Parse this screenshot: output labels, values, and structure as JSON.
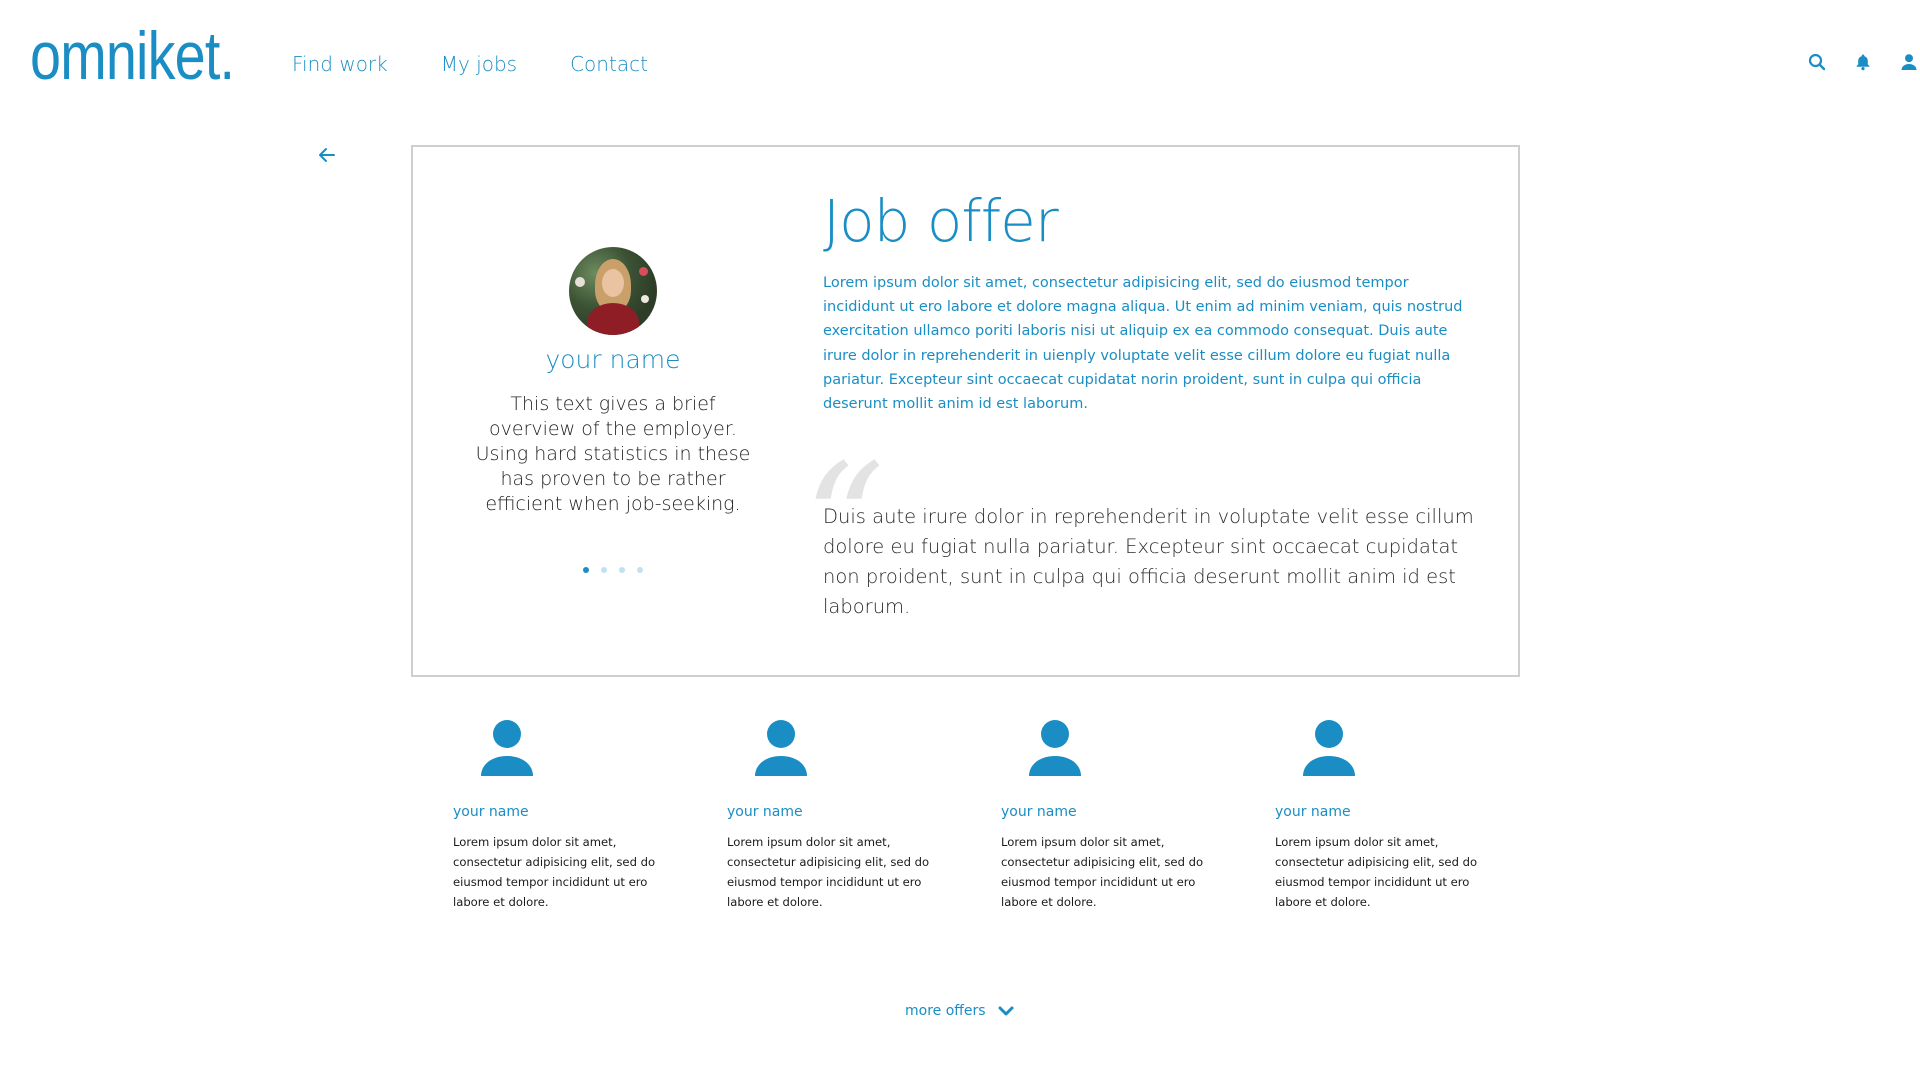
{
  "header": {
    "logo": "omniket.",
    "nav": [
      "Find work",
      "My jobs",
      "Contact"
    ],
    "icons": [
      "search-icon",
      "bell-icon",
      "user-icon"
    ]
  },
  "card": {
    "profile": {
      "name": "your name",
      "description": "This text gives a brief overview of the employer. Using hard statistics in these has proven to be rather efficient when job-seeking.",
      "carousel_dots": 4,
      "active_dot": 1
    },
    "title": "Job offer",
    "description": "Lorem ipsum dolor sit amet, consectetur adipisicing elit, sed do eiusmod tempor incididunt ut ero labore et dolore magna aliqua. Ut enim ad minim veniam, quis nostrud exercitation ullamco poriti laboris nisi ut aliquip ex ea commodo consequat. Duis aute irure dolor in reprehenderit in uienply voluptate velit esse cillum dolore eu fugiat nulla pariatur. Excepteur sint occaecat cupidatat norin proident, sunt in culpa qui officia deserunt mollit anim id est laborum.",
    "quote_mark": "“",
    "quote": "Duis aute irure dolor in reprehenderit in voluptate velit esse cillum dolore eu fugiat nulla pariatur. Excepteur sint occaecat cupidatat non proident, sunt in culpa qui officia deserunt mollit anim id est laborum."
  },
  "people": [
    {
      "name": "your name",
      "text": "Lorem ipsum dolor sit amet, consectetur adipisicing elit, sed do eiusmod tempor incididunt ut ero labore et dolore."
    },
    {
      "name": "your name",
      "text": "Lorem ipsum dolor sit amet, consectetur adipisicing elit, sed do eiusmod tempor incididunt ut ero labore et dolore."
    },
    {
      "name": "your name",
      "text": "Lorem ipsum dolor sit amet, consectetur adipisicing elit, sed do eiusmod tempor incididunt ut ero labore et dolore."
    },
    {
      "name": "your name",
      "text": "Lorem ipsum dolor sit amet, consectetur adipisicing elit, sed do eiusmod tempor incididunt ut ero labore et dolore."
    }
  ],
  "more_offers": "more offers",
  "colors": {
    "accent": "#1a8ec4",
    "border": "#cfcfcf",
    "quote_mark": "#e3e3e3"
  }
}
